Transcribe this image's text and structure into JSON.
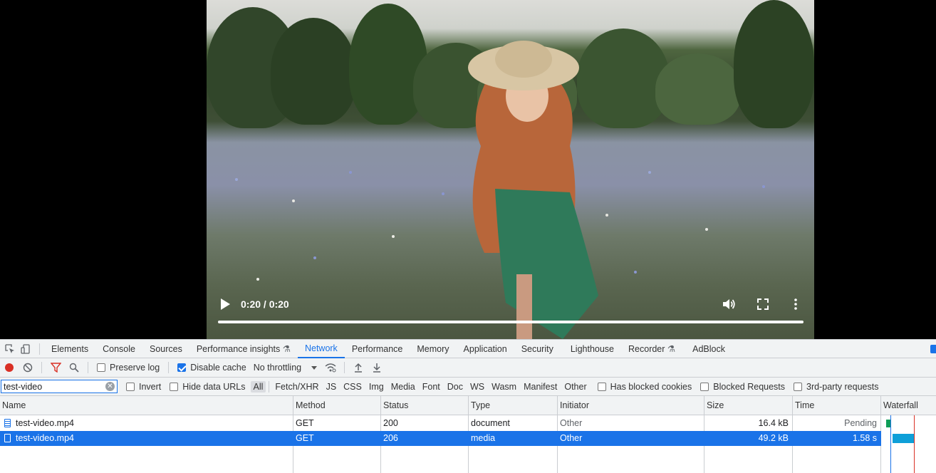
{
  "video": {
    "time": "0:20 / 0:20",
    "icons": {
      "play": "play-icon",
      "volume": "volume-icon",
      "fullscreen": "fullscreen-icon",
      "more": "more-vert-icon"
    },
    "progress_fraction": 1.0
  },
  "devtools": {
    "tabs": [
      {
        "label": "Elements"
      },
      {
        "label": "Console"
      },
      {
        "label": "Sources"
      },
      {
        "label": "Performance insights"
      },
      {
        "label": "Network",
        "active": true
      },
      {
        "label": "Performance"
      },
      {
        "label": "Memory"
      },
      {
        "label": "Application"
      },
      {
        "label": "Security"
      },
      {
        "label": "Lighthouse"
      },
      {
        "label": "Recorder"
      },
      {
        "label": "AdBlock"
      }
    ],
    "toolbar": {
      "preserve_log": "Preserve log",
      "disable_cache": "Disable cache",
      "throttling": "No throttling"
    },
    "filter": {
      "value": "test-video",
      "invert": "Invert",
      "hide_data_urls": "Hide data URLs",
      "types": [
        "All",
        "Fetch/XHR",
        "JS",
        "CSS",
        "Img",
        "Media",
        "Font",
        "Doc",
        "WS",
        "Wasm",
        "Manifest",
        "Other"
      ],
      "has_blocked_cookies": "Has blocked cookies",
      "blocked_requests": "Blocked Requests",
      "third_party": "3rd-party requests"
    },
    "columns": [
      "Name",
      "Method",
      "Status",
      "Type",
      "Initiator",
      "Size",
      "Time",
      "Waterfall"
    ],
    "rows": [
      {
        "name": "test-video.mp4",
        "method": "GET",
        "status": "200",
        "type": "document",
        "initiator": "Other",
        "size": "16.4 kB",
        "time": "Pending"
      },
      {
        "name": "test-video.mp4",
        "method": "GET",
        "status": "206",
        "type": "media",
        "initiator": "Other",
        "size": "49.2 kB",
        "time": "1.58 s"
      }
    ],
    "colors": {
      "accent": "#1a73e8",
      "record": "#d93025",
      "waterfall_doc": "#0f9d58",
      "waterfall_media": "#0e9fd8"
    }
  }
}
